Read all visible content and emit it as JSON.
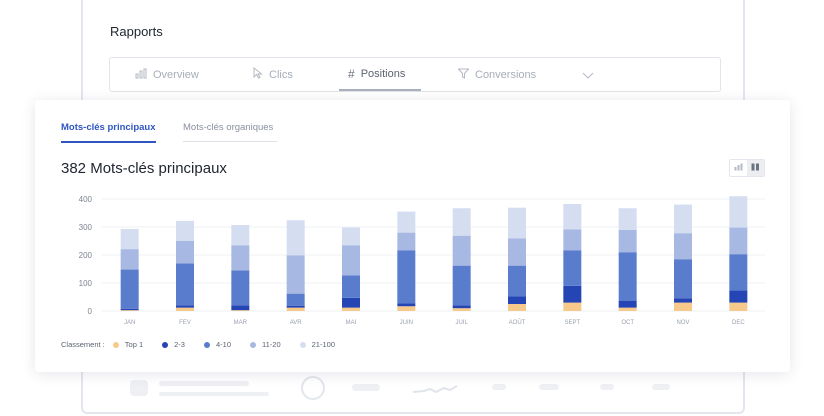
{
  "report": {
    "title": "Rapports",
    "tabs": [
      {
        "label": "Overview",
        "icon": "bar-chart-icon"
      },
      {
        "label": "Clics",
        "icon": "cursor-icon"
      },
      {
        "label": "Positions",
        "icon": "hash-icon"
      },
      {
        "label": "Conversions",
        "icon": "funnel-icon"
      }
    ],
    "active_tab": "Positions"
  },
  "card": {
    "tabs": [
      {
        "label": "Mots-clés principaux",
        "active": true
      },
      {
        "label": "Mots-clés organiques",
        "active": false
      }
    ],
    "heading": "382 Mots-clés principaux"
  },
  "chart_data": {
    "type": "bar",
    "stacked": true,
    "categories": [
      "JAN",
      "FEV",
      "MAR",
      "AVR",
      "MAI",
      "JUIN",
      "JUIL",
      "AOÛT",
      "SEPT",
      "OCT",
      "NOV",
      "DEC"
    ],
    "ylim": [
      0,
      400
    ],
    "yticks": [
      0,
      100,
      200,
      300,
      400
    ],
    "grid": true,
    "series": [
      {
        "name": "Top 1",
        "color": "#f7c98b",
        "values": [
          3,
          12,
          3,
          12,
          12,
          17,
          10,
          25,
          30,
          12,
          30,
          30
        ]
      },
      {
        "name": "2-3",
        "color": "#2545b5",
        "values": [
          5,
          8,
          17,
          7,
          35,
          10,
          10,
          27,
          60,
          25,
          15,
          43
        ]
      },
      {
        "name": "4-10",
        "color": "#5a7ccd",
        "values": [
          140,
          150,
          125,
          43,
          80,
          190,
          142,
          110,
          127,
          173,
          140,
          130
        ]
      },
      {
        "name": "11-20",
        "color": "#a7b8e3",
        "values": [
          73,
          80,
          90,
          137,
          108,
          63,
          107,
          97,
          75,
          80,
          93,
          95
        ]
      },
      {
        "name": "21-100",
        "color": "#d5ddf1",
        "values": [
          72,
          72,
          72,
          125,
          63,
          75,
          98,
          110,
          90,
          77,
          102,
          112
        ]
      }
    ],
    "legend_title": "Classement :",
    "legend_position": "bottom-left"
  }
}
